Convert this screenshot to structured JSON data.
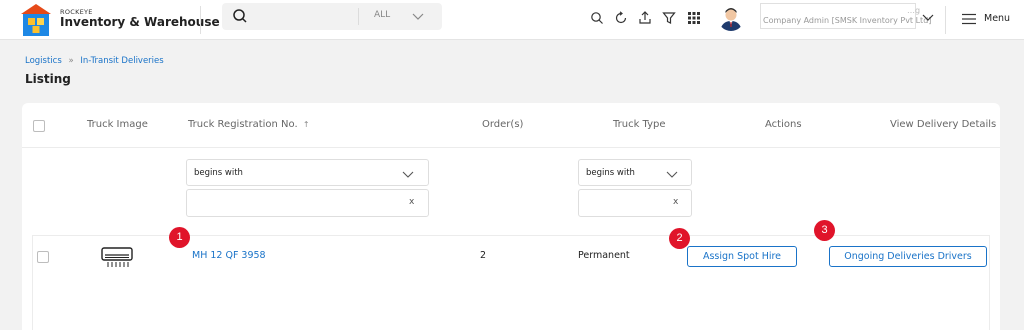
{
  "app": {
    "brand_small": "ROCKEYE",
    "brand_name": "Inventory & Warehouse"
  },
  "search": {
    "placeholder": "",
    "scope": "ALL"
  },
  "toolbar_icons": [
    "search-icon",
    "refresh-icon",
    "download-icon",
    "filter-icon",
    "apps-grid-icon"
  ],
  "user": {
    "name": "…g",
    "role": "Company Admin [SMSK Inventory Pvt Ltd]"
  },
  "menu": {
    "label": "Menu"
  },
  "breadcrumb": {
    "items": [
      "Logistics",
      "In-Transit Deliveries"
    ],
    "separator": "»"
  },
  "page": {
    "title": "Listing"
  },
  "table": {
    "headers": {
      "truck_image": "Truck Image",
      "registration": "Truck Registration No.",
      "sort_indicator": "↑",
      "orders": "Order(s)",
      "truck_type": "Truck Type",
      "actions": "Actions",
      "view_details": "View Delivery Details"
    },
    "filters": {
      "registration": {
        "mode": "begins with",
        "value": "",
        "clear": "x"
      },
      "truck_type": {
        "mode": "begins with",
        "value": "",
        "clear": "x"
      }
    },
    "rows": [
      {
        "registration": "MH 12 QF 3958",
        "orders": "2",
        "truck_type": "Permanent",
        "action_label": "Assign Spot Hire",
        "details_label": "Ongoing Deliveries Drivers"
      }
    ]
  },
  "markers": [
    "1",
    "2",
    "3"
  ],
  "colors": {
    "accent": "#1a73c8",
    "marker": "#e0142a",
    "page_bg": "#f2f2f2"
  }
}
